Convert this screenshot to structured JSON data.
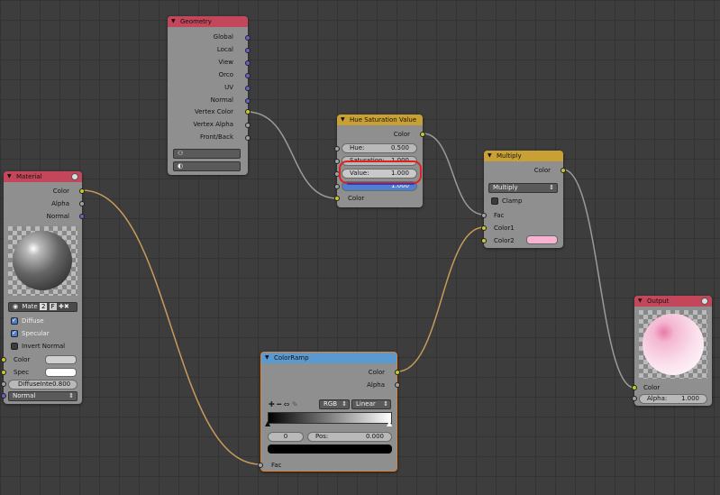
{
  "colors": {
    "accent": "#e84d6b",
    "header_input": "#c4465b",
    "header_converter": "#c9a034",
    "header_ramp": "#5b9ad0",
    "wire": "#c79a5a",
    "wire_grey": "#a0a0a0",
    "highlight": "#e12020"
  },
  "geometry": {
    "title": "Geometry",
    "outputs": [
      "Global",
      "Local",
      "View",
      "Orco",
      "UV",
      "Normal",
      "Vertex Color",
      "Vertex Alpha",
      "Front/Back"
    ]
  },
  "hsv": {
    "title": "Hue Saturation Value",
    "output": "Color",
    "hue_label": "Hue:",
    "hue_value": "0.500",
    "sat_label": "Saturation:",
    "sat_value": "1.000",
    "val_label": "Value:",
    "val_value": "1.000",
    "fac_value": "1.000",
    "color_input": "Color"
  },
  "multiply": {
    "title": "Multiply",
    "output": "Color",
    "mode": "Multiply",
    "clamp": "Clamp",
    "inputs": [
      "Fac",
      "Color1",
      "Color2"
    ],
    "color2": "#f7b3cf"
  },
  "material": {
    "title": "Material",
    "outputs": [
      "Color",
      "Alpha",
      "Normal"
    ],
    "mat_name": "Mate",
    "users": "2",
    "fake": "F",
    "diffuse": "Diffuse",
    "specular": "Specular",
    "invert_normal": "Invert Normal",
    "color_label": "Color",
    "spec_label": "Spec",
    "diffuse_intensity": "DiffuseInte0.800",
    "normal_label": "Normal"
  },
  "colorramp": {
    "title": "ColorRamp",
    "outputs": [
      "Color",
      "Alpha"
    ],
    "mode": "RGB",
    "interp": "Linear",
    "index": "0",
    "pos_label": "Pos:",
    "pos_value": "0.000",
    "input": "Fac"
  },
  "output": {
    "title": "Output",
    "color_label": "Color",
    "alpha_label": "Alpha:",
    "alpha_value": "1.000"
  }
}
